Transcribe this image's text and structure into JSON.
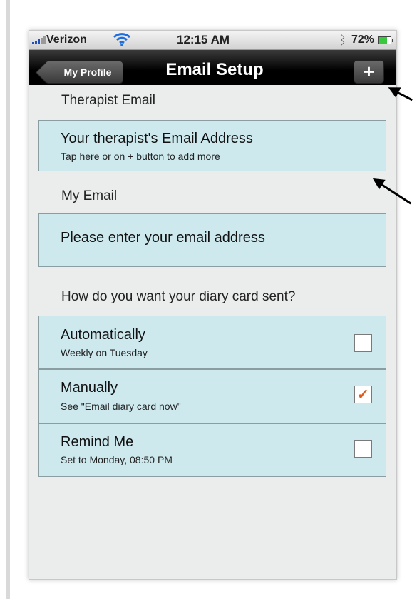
{
  "status_bar": {
    "carrier": "Verizon",
    "time": "12:15 AM",
    "battery_text": "72%",
    "battery_level": 0.72,
    "icons": [
      "signal-bars-icon",
      "wifi-icon",
      "bluetooth-icon",
      "battery-icon"
    ]
  },
  "navbar": {
    "back_label": "My Profile",
    "title": "Email Setup",
    "add_label": "+"
  },
  "therapist": {
    "section_label": "Therapist Email",
    "title": "Your therapist's Email Address",
    "subtitle": "Tap here or on + button to add more"
  },
  "my_email": {
    "section_label": "My Email",
    "placeholder": "Please enter your email address"
  },
  "delivery": {
    "section_label": "How do you want your diary card sent?",
    "options": [
      {
        "title": "Automatically",
        "subtitle": "Weekly on Tuesday",
        "checked": false
      },
      {
        "title": "Manually",
        "subtitle": "See \"Email diary card now\"",
        "checked": true
      },
      {
        "title": "Remind Me",
        "subtitle": "Set to Monday, 08:50 PM",
        "checked": false
      }
    ]
  },
  "colors": {
    "cell_background": "#cde9ee",
    "checkmark": "#e05a1a",
    "battery_fill": "#39c93f"
  }
}
